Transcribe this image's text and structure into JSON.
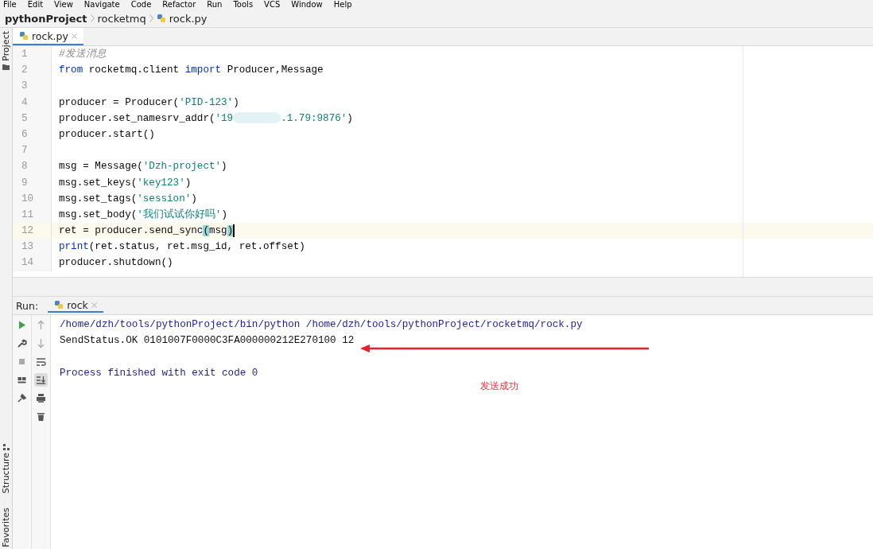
{
  "menu": [
    "File",
    "Edit",
    "View",
    "Navigate",
    "Code",
    "Refactor",
    "Run",
    "Tools",
    "VCS",
    "Window",
    "Help"
  ],
  "breadcrumbs": [
    {
      "label": "pythonProject",
      "kind": "project"
    },
    {
      "label": "rocketmq",
      "kind": "folder"
    },
    {
      "label": "rock.py",
      "kind": "file"
    }
  ],
  "side_tools_top": [
    {
      "label": "Project",
      "kind": "folder"
    }
  ],
  "side_tools_bottom": [
    {
      "label": "Structure",
      "kind": "structure"
    },
    {
      "label": "Favorites",
      "kind": "none"
    }
  ],
  "editor": {
    "tabs": [
      {
        "label": "rock.py",
        "selected": true
      }
    ],
    "lines": [
      {
        "number": "1",
        "current": false,
        "tokens": [
          {
            "kind": "comment",
            "text": "#发送消息"
          }
        ]
      },
      {
        "number": "2",
        "current": false,
        "tokens": [
          {
            "kind": "keyword",
            "text": "from"
          },
          {
            "kind": "plain",
            "text": " rocketmq.client "
          },
          {
            "kind": "keyword",
            "text": "import"
          },
          {
            "kind": "plain",
            "text": " Producer,Message"
          }
        ]
      },
      {
        "number": "3",
        "current": false
      },
      {
        "number": "4",
        "current": false,
        "tokens": [
          {
            "kind": "plain",
            "text": "producer = Producer("
          },
          {
            "kind": "string",
            "text": "'PID-123'"
          },
          {
            "kind": "plain",
            "text": ")"
          }
        ]
      },
      {
        "number": "5",
        "current": false,
        "tokens": [
          {
            "kind": "plain",
            "text": "producer.set_namesrv_addr("
          },
          {
            "kind": "string",
            "text": "'19"
          },
          {
            "kind": "redacted"
          },
          {
            "kind": "string",
            "text": ".1.79:9876'"
          },
          {
            "kind": "plain",
            "text": ")"
          }
        ]
      },
      {
        "number": "6",
        "current": false,
        "tokens": [
          {
            "kind": "plain",
            "text": "producer.start()"
          }
        ]
      },
      {
        "number": "7",
        "current": false
      },
      {
        "number": "8",
        "current": false,
        "tokens": [
          {
            "kind": "plain",
            "text": "msg = Message("
          },
          {
            "kind": "string",
            "text": "'Dzh-project'"
          },
          {
            "kind": "plain",
            "text": ")"
          }
        ]
      },
      {
        "number": "9",
        "current": false,
        "tokens": [
          {
            "kind": "plain",
            "text": "msg.set_keys("
          },
          {
            "kind": "string",
            "text": "'key123'"
          },
          {
            "kind": "plain",
            "text": ")"
          }
        ]
      },
      {
        "number": "10",
        "current": false,
        "tokens": [
          {
            "kind": "plain",
            "text": "msg.set_tags("
          },
          {
            "kind": "string",
            "text": "'session'"
          },
          {
            "kind": "plain",
            "text": ")"
          }
        ]
      },
      {
        "number": "11",
        "current": false,
        "tokens": [
          {
            "kind": "plain",
            "text": "msg.set_body("
          },
          {
            "kind": "string",
            "text": "'我们试试你好吗'"
          },
          {
            "kind": "plain",
            "text": ")"
          }
        ]
      },
      {
        "number": "12",
        "current": true,
        "tokens": [
          {
            "kind": "plain",
            "text": "ret = producer.send_sync"
          },
          {
            "kind": "match",
            "text": "("
          },
          {
            "kind": "plain",
            "text": "msg"
          },
          {
            "kind": "match",
            "text": ")"
          }
        ]
      },
      {
        "number": "13",
        "current": false,
        "tokens": [
          {
            "kind": "keyword",
            "text": "print"
          },
          {
            "kind": "plain",
            "text": "(ret.status, ret.msg_id, ret.offset)"
          }
        ]
      },
      {
        "number": "14",
        "current": false,
        "tokens": [
          {
            "kind": "plain",
            "text": "producer.shutdown()"
          }
        ]
      }
    ]
  },
  "run": {
    "title": "Run:",
    "tabs": [
      {
        "label": "rock",
        "selected": true
      }
    ],
    "scroll_to_end": true,
    "output": [
      {
        "kind": "system",
        "text": "/home/dzh/tools/pythonProject/bin/python /home/dzh/tools/pythonProject/rocketmq/rock.py"
      },
      {
        "kind": "stdout",
        "text": "SendStatus.OK 0101007F0000C3FA000000212E270100 12"
      },
      {
        "kind": "blank"
      },
      {
        "kind": "system",
        "text": "Process finished with exit code 0"
      }
    ]
  },
  "annotation": {
    "text": "发送成功"
  }
}
